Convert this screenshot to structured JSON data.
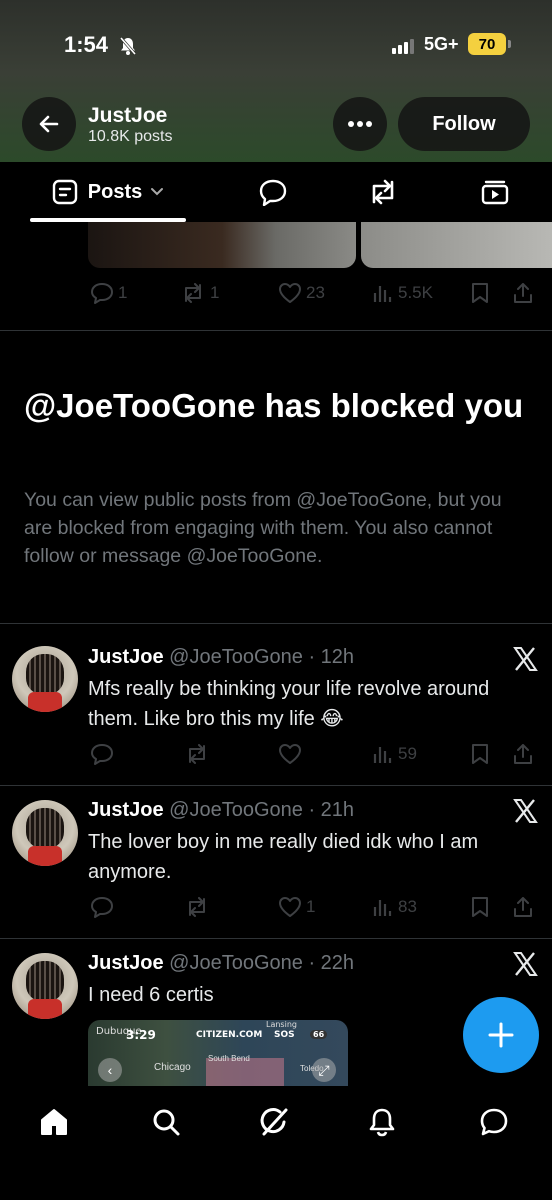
{
  "status_bar": {
    "time": "1:54",
    "network": "5G+",
    "battery": "70"
  },
  "header": {
    "name": "JustJoe",
    "posts_count": "10.8K posts",
    "follow_label": "Follow"
  },
  "tabs": {
    "posts_label": "Posts"
  },
  "prev_post": {
    "replies": "1",
    "reposts": "1",
    "likes": "23",
    "views": "5.5K"
  },
  "blocked": {
    "title": "@JoeTooGone has blocked you",
    "body": "You can view public posts from @JoeTooGone, but you are blocked from engaging with them. You also cannot follow or message @JoeTooGone."
  },
  "posts": [
    {
      "name": "JustJoe",
      "handle": "@JoeTooGone",
      "time": "12h",
      "text": "Mfs really be thinking your life revolve around them. Like bro this my life 😂",
      "replies": "",
      "reposts": "",
      "likes": "",
      "views": "59"
    },
    {
      "name": "JustJoe",
      "handle": "@JoeTooGone",
      "time": "21h",
      "text": "The lover boy in me really died idk who I am anymore.",
      "replies": "",
      "reposts": "",
      "likes": "1",
      "views": "83"
    },
    {
      "name": "JustJoe",
      "handle": "@JoeTooGone",
      "time": "22h",
      "text": "I need 6 certis",
      "media": {
        "left_tag": "Dubuque",
        "clock": "3:29",
        "brand": "CITIZEN.COM",
        "sos_label": "SOS",
        "badge": "66",
        "city_a": "Chicago",
        "city_b": "South Bend",
        "city_c": "Lansing",
        "city_d": "Toledo"
      }
    }
  ],
  "colors": {
    "accent": "#1d9bf0",
    "muted": "#71767b",
    "battery": "#f4d03f"
  }
}
